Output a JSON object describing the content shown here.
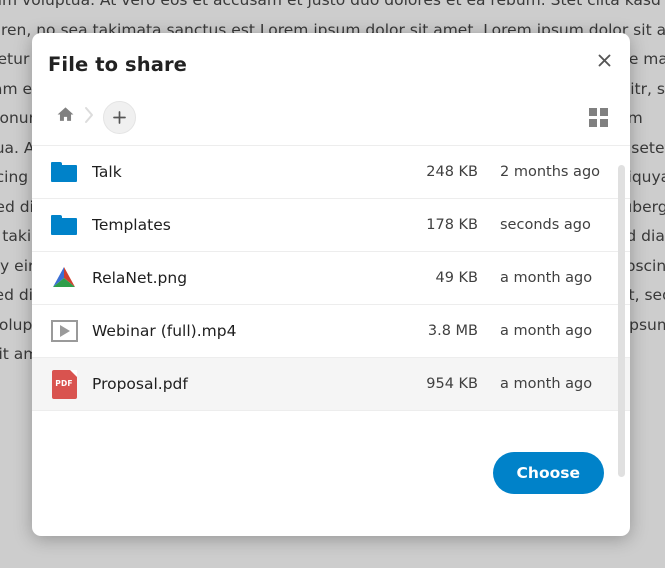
{
  "background": {
    "body_text": "sed diam voluptua. At vero eos et accusam et justo duo dolores et ea rebum. Stet clita kasd gubergren, no sea takimata sanctus est Lorem ipsum dolor sit amet. Lorem ipsum dolor sit amet, consetetur sadipscing elitr, sed diam nonumy eirmod tempor invidunt ut labore et dolore magna aliquyam erat, sed diam voluptua. Lorem ipsum dolor sit amet, consetetur sadipscing elitr, sed diam nonumy eirmod tempor invidunt ut labore et dolore magna aliquyam erat, sed diam voluptua. At vero eos et justo duo dolores et ea rebum. Lorem ipsum dolor sit amet, consetetur sadipscing elitr, sed diam nonumy eirmod tempor invidunt ut labore et dolore magna aliquyam erat, sed diam voluptua. At vero eos et justo duo dolores et ea rebum. Stet clita kasd gubergren, no sea takimata sanctus est Lorem ipsum dolor sit amet, consetetur sadipscing elitr, sed diam nonumy eirmod tempor invidunt ut labore. Lorem ipsum dolor sit amet, consetetur sadipscing elitr, sed diam nonumy eirmod tempor invidunt ut labore et dolore magna aliquyam erat, sed diam voluptua. At vero eos et accusam sanctus est Lorem ipsum dolor sit amet. Lorem ipsum dolor sit amet, consetetur sadipscing elitr."
  },
  "dialog": {
    "title": "File to share",
    "close_label": "✕",
    "breadcrumb": {
      "home_label": "Home",
      "separator": "›",
      "add_label": "+"
    },
    "view_toggle_label": "Grid view",
    "files": [
      {
        "name": "Talk",
        "size": "248 KB",
        "modified": "2 months ago",
        "icon": "folder-icon",
        "selected": false
      },
      {
        "name": "Templates",
        "size": "178 KB",
        "modified": "seconds ago",
        "icon": "folder-icon",
        "selected": false
      },
      {
        "name": "RelaNet.png",
        "size": "49 KB",
        "modified": "a month ago",
        "icon": "image-icon",
        "selected": false
      },
      {
        "name": "Webinar (full).mp4",
        "size": "3.8 MB",
        "modified": "a month ago",
        "icon": "video-icon",
        "selected": false
      },
      {
        "name": "Proposal.pdf",
        "size": "954 KB",
        "modified": "a month ago",
        "icon": "pdf-icon",
        "selected": true
      }
    ],
    "pdf_badge_label": "PDF",
    "choose_label": "Choose"
  },
  "colors": {
    "accent": "#0082c9",
    "folder": "#0082c9",
    "pdf": "#d9534f",
    "selected_row": "#f5f5f5",
    "separator": "#ededed"
  }
}
